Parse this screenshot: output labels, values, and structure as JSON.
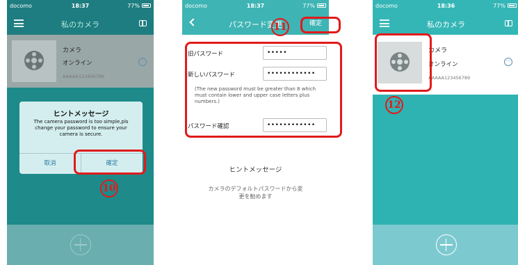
{
  "annotations": {
    "step1": "10",
    "step2": "11",
    "step3": "12"
  },
  "screen1": {
    "status": {
      "carrier": "docomo",
      "time": "18:37",
      "battery": "77%"
    },
    "title": "私のカメラ",
    "camera": {
      "name": "カメラ",
      "status": "オンライン",
      "id": "AAAAA123456789"
    },
    "dialog": {
      "title": "ヒントメッセージ",
      "message": "The camera password is too simple,pls change your password to ensure your camera is secure.",
      "cancel": "取消",
      "confirm": "確定"
    }
  },
  "screen2": {
    "status": {
      "carrier": "docomo",
      "time": "18:37",
      "battery": "77%"
    },
    "title": "パスワード変更",
    "confirm": "確定",
    "old_password": {
      "label": "旧パスワード",
      "value": "•••••"
    },
    "new_password": {
      "label": "新しいパスワード",
      "value": "••••••••••••"
    },
    "note": "(The new password must be greater than 8 which must contain lower and upper case letters plus numbers.)",
    "confirm_password": {
      "label": "パスワード確認",
      "value": "••••••••••••"
    },
    "hint_title": "ヒントメッセージ",
    "hint_body": "カメラのデフォルトパスワードから変更を勧めます"
  },
  "screen3": {
    "status": {
      "carrier": "docomo",
      "time": "18:36",
      "battery": "77%"
    },
    "title": "私のカメラ",
    "camera": {
      "name": "カメラ",
      "status": "オンライン",
      "id": "AAAAA123456789"
    }
  },
  "colors": {
    "accent": "#3fb4b4",
    "annotation": "#e21a1a"
  }
}
